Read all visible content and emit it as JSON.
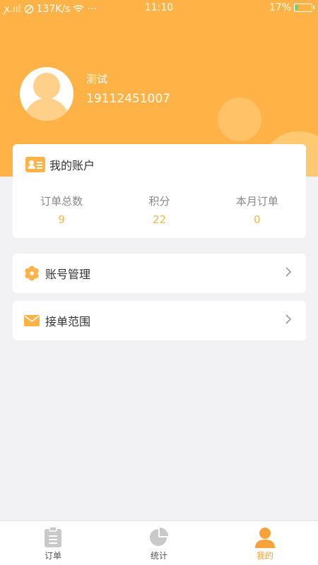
{
  "status_bar": {
    "signal_text": "ꭗ.ııl",
    "speed": "137K/s",
    "dots": "···",
    "time": "11:10",
    "battery": "17%",
    "battery_level": 0.17
  },
  "profile": {
    "name": "测试",
    "phone": "19112451007"
  },
  "account": {
    "title": "我的账户",
    "stats": [
      {
        "label": "订单总数",
        "value": "9"
      },
      {
        "label": "积分",
        "value": "22"
      },
      {
        "label": "本月订单",
        "value": "0"
      }
    ]
  },
  "menu": [
    {
      "label": "账号管理",
      "icon": "gear-icon"
    },
    {
      "label": "接单范围",
      "icon": "envelope-icon"
    }
  ],
  "tabs": [
    {
      "label": "订单",
      "icon": "clipboard-icon",
      "active": false
    },
    {
      "label": "统计",
      "icon": "pie-chart-icon",
      "active": false
    },
    {
      "label": "我的",
      "icon": "user-icon",
      "active": true
    }
  ],
  "colors": {
    "brand": "#ffb347",
    "value": "#f2b84b",
    "active_tab": "#f7a23b"
  }
}
